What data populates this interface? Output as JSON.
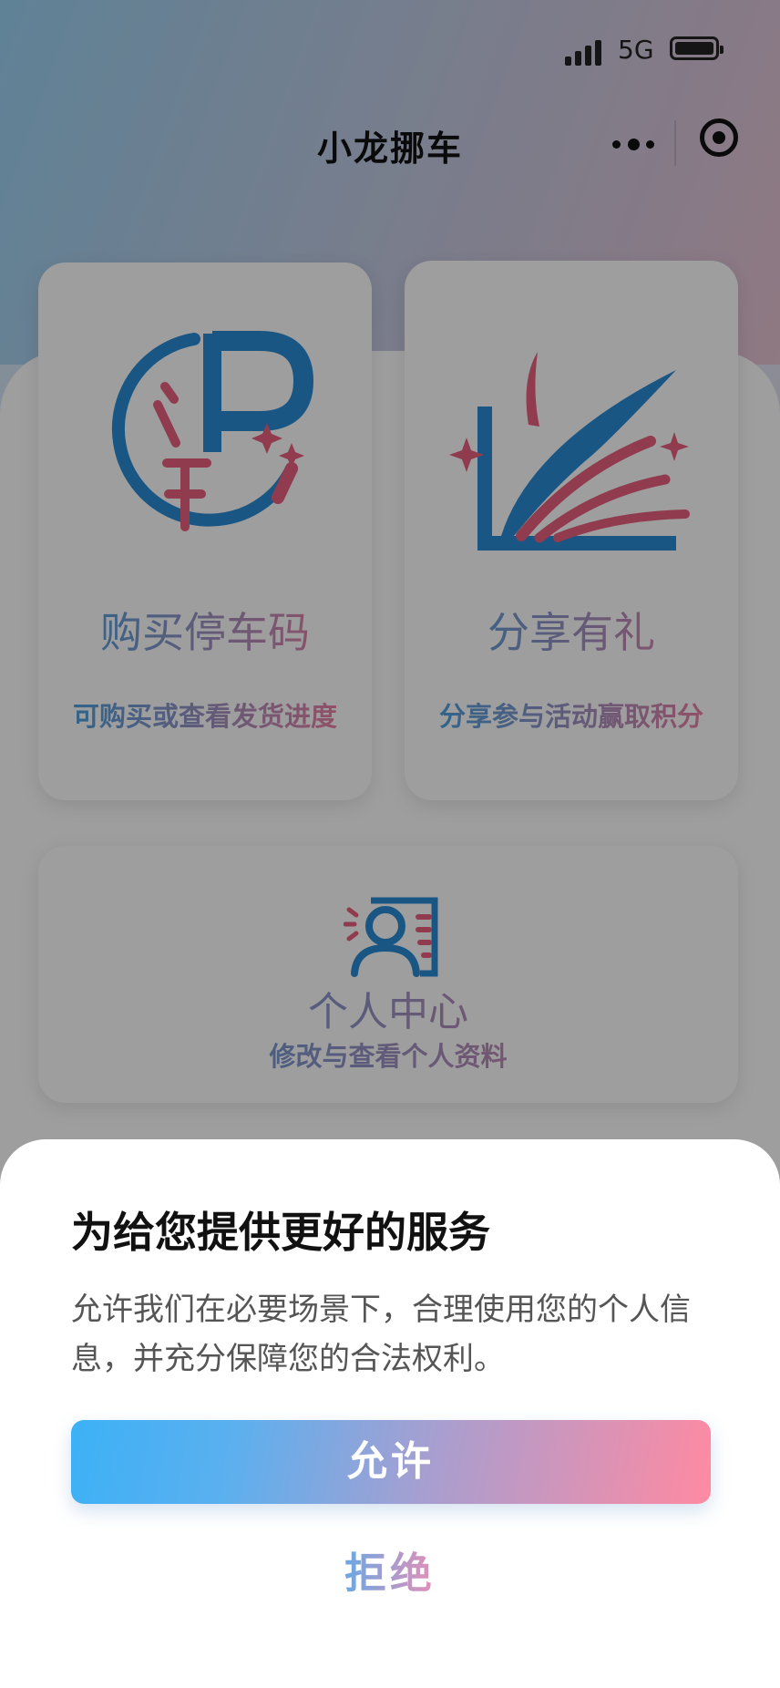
{
  "status_bar": {
    "network": "5G"
  },
  "nav": {
    "title": "小龙挪车"
  },
  "cards": [
    {
      "title": "购买停车码",
      "subtitle": "可购买或查看发货进度"
    },
    {
      "title": "分享有礼",
      "subtitle": "分享参与活动赢取积分"
    },
    {
      "title": "个人中心",
      "subtitle": "修改与查看个人资料"
    }
  ],
  "privacy_sheet": {
    "title": "为给您提供更好的服务",
    "description": "允许我们在必要场景下，合理使用您的个人信息，并充分保障您的合法权利。",
    "allow_label": "允许",
    "reject_label": "拒绝"
  },
  "colors": {
    "brand_blue": "#3ba6e8",
    "brand_pink": "#ff7fa0",
    "card_bg": "#ffffff"
  },
  "icons": [
    "signal-icon",
    "battery-icon",
    "more-icon",
    "close-capsule-icon",
    "parking-code-icon",
    "share-gift-icon",
    "profile-icon"
  ]
}
